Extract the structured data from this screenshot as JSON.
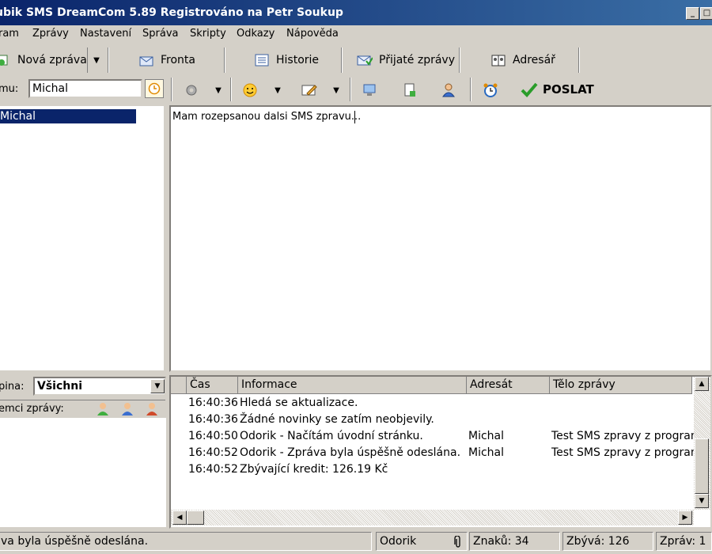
{
  "window": {
    "title": "ubik SMS DreamCom 5.89 Registrováno na Petr Soukup",
    "minimize_glyph": "_",
    "maximize_glyph": "□"
  },
  "menu": [
    {
      "label": "ram"
    },
    {
      "label": "Zprávy"
    },
    {
      "label": "Nastavení"
    },
    {
      "label": "Správa"
    },
    {
      "label": "Skripty"
    },
    {
      "label": "Odkazy"
    },
    {
      "label": "Nápověda"
    }
  ],
  "toolbar": {
    "new_message": "Nová zpráva",
    "queue": "Fronta",
    "history": "Historie",
    "received": "Přijaté zprávy",
    "addressbook": "Adresář",
    "send": "POSLAT"
  },
  "recipient": {
    "label": "mu:",
    "value": "Michal"
  },
  "contacts": [
    "Michal"
  ],
  "message_text": "Mam rozepsanou dalsi SMS zpravu...",
  "group": {
    "label": "pina:",
    "value": "Všichni",
    "recipients_label": "emci zprávy:"
  },
  "log": {
    "columns": [
      "Čas",
      "Informace",
      "Adresát",
      "Tělo zprávy"
    ],
    "rows": [
      {
        "time": "16:40:36",
        "info": "Hledá se aktualizace.",
        "to": "",
        "body": ""
      },
      {
        "time": "16:40:36",
        "info": "Žádné novinky se zatím neobjevily.",
        "to": "",
        "body": ""
      },
      {
        "time": "16:40:50",
        "info": "Odorik - Načítám úvodní stránku.",
        "to": "Michal",
        "body": "Test SMS zpravy z programu"
      },
      {
        "time": "16:40:52",
        "info": "Odorik - Zpráva byla úspěšně odeslána.",
        "to": "Michal",
        "body": "Test SMS zpravy z programu"
      },
      {
        "time": "16:40:52",
        "info": "Zbývající kredit: 126.19 Kč",
        "to": "",
        "body": ""
      }
    ]
  },
  "statusbar": {
    "message": "va byla úspěšně odeslána.",
    "gateway": "Odorik",
    "chars": "Znaků: 34",
    "remaining": "Zbývá: 126",
    "messages": "Zpráv: 1"
  },
  "colors": {
    "titlebar": "#0a246a",
    "selection": "#0a246a",
    "face": "#d4d0c8",
    "send_check": "#2a9d2a"
  }
}
